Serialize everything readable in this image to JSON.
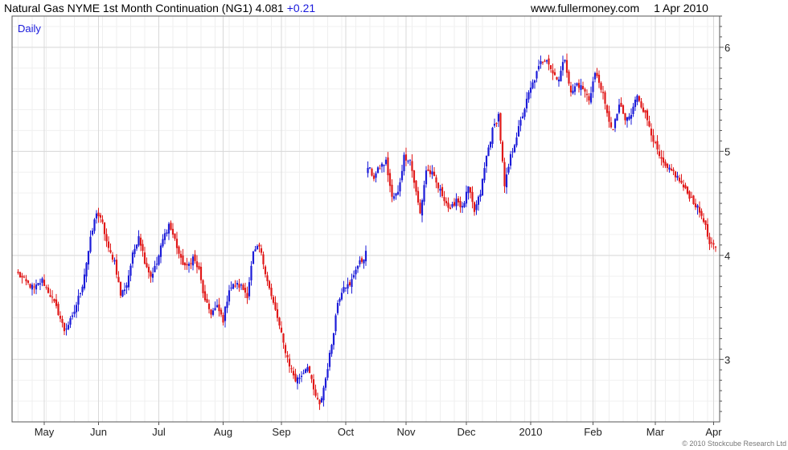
{
  "header": {
    "instrument": "Natural Gas NYME 1st Month Continuation (NG1)",
    "last": "4.081",
    "change": "+0.21",
    "site": "www.fullermoney.com",
    "date": "1 Apr 2010"
  },
  "copyright": "© 2010 Stockcube Research Ltd",
  "colors": {
    "up": "#1c1cd8",
    "down": "#e01818",
    "grid": "#d9d9d9",
    "axis": "#555555"
  },
  "chart_data": {
    "type": "candlestick",
    "period_label": "Daily",
    "y_ticks": [
      3,
      4,
      5,
      6
    ],
    "ylim": [
      2.4,
      6.3
    ],
    "x_tick_labels": [
      "May",
      "Jun",
      "Jul",
      "Aug",
      "Sep",
      "Oct",
      "Nov",
      "Dec",
      "2010",
      "Feb",
      "Mar",
      "Apr"
    ],
    "x_tick_days": [
      13,
      40,
      70,
      102,
      131,
      163,
      193,
      223,
      255,
      286,
      317,
      346
    ],
    "last_day": 347,
    "close_anchors": [
      [
        0,
        3.82
      ],
      [
        4,
        3.74
      ],
      [
        8,
        3.68
      ],
      [
        12,
        3.76
      ],
      [
        16,
        3.62
      ],
      [
        20,
        3.45
      ],
      [
        23,
        3.28
      ],
      [
        27,
        3.4
      ],
      [
        32,
        3.72
      ],
      [
        36,
        4.15
      ],
      [
        39,
        4.42
      ],
      [
        42,
        4.3
      ],
      [
        45,
        4.05
      ],
      [
        48,
        3.95
      ],
      [
        51,
        3.62
      ],
      [
        54,
        3.72
      ],
      [
        57,
        4.0
      ],
      [
        60,
        4.2
      ],
      [
        63,
        3.95
      ],
      [
        66,
        3.8
      ],
      [
        69,
        3.92
      ],
      [
        72,
        4.15
      ],
      [
        75,
        4.3
      ],
      [
        78,
        4.15
      ],
      [
        81,
        3.95
      ],
      [
        84,
        3.88
      ],
      [
        87,
        3.98
      ],
      [
        90,
        3.85
      ],
      [
        93,
        3.55
      ],
      [
        96,
        3.45
      ],
      [
        99,
        3.5
      ],
      [
        102,
        3.38
      ],
      [
        105,
        3.68
      ],
      [
        108,
        3.72
      ],
      [
        111,
        3.7
      ],
      [
        114,
        3.62
      ],
      [
        117,
        4.02
      ],
      [
        120,
        4.08
      ],
      [
        123,
        3.85
      ],
      [
        126,
        3.6
      ],
      [
        129,
        3.4
      ],
      [
        132,
        3.15
      ],
      [
        135,
        2.95
      ],
      [
        138,
        2.8
      ],
      [
        141,
        2.85
      ],
      [
        144,
        2.95
      ],
      [
        147,
        2.7
      ],
      [
        150,
        2.55
      ],
      [
        153,
        2.82
      ],
      [
        156,
        3.15
      ],
      [
        159,
        3.55
      ],
      [
        162,
        3.72
      ],
      [
        165,
        3.7
      ],
      [
        168,
        3.88
      ],
      [
        171,
        3.95
      ],
      [
        173,
        4.02
      ],
      [
        174,
        4.85
      ],
      [
        177,
        4.75
      ],
      [
        180,
        4.85
      ],
      [
        183,
        4.9
      ],
      [
        186,
        4.55
      ],
      [
        189,
        4.6
      ],
      [
        192,
        4.95
      ],
      [
        195,
        4.92
      ],
      [
        198,
        4.6
      ],
      [
        200,
        4.4
      ],
      [
        203,
        4.82
      ],
      [
        206,
        4.78
      ],
      [
        209,
        4.65
      ],
      [
        212,
        4.55
      ],
      [
        215,
        4.42
      ],
      [
        218,
        4.55
      ],
      [
        221,
        4.45
      ],
      [
        224,
        4.65
      ],
      [
        227,
        4.42
      ],
      [
        230,
        4.6
      ],
      [
        233,
        4.95
      ],
      [
        236,
        5.2
      ],
      [
        239,
        5.35
      ],
      [
        242,
        4.65
      ],
      [
        245,
        4.95
      ],
      [
        248,
        5.15
      ],
      [
        251,
        5.35
      ],
      [
        254,
        5.55
      ],
      [
        257,
        5.7
      ],
      [
        260,
        5.85
      ],
      [
        263,
        5.9
      ],
      [
        266,
        5.75
      ],
      [
        269,
        5.7
      ],
      [
        272,
        5.9
      ],
      [
        275,
        5.55
      ],
      [
        278,
        5.65
      ],
      [
        281,
        5.6
      ],
      [
        284,
        5.5
      ],
      [
        287,
        5.75
      ],
      [
        290,
        5.62
      ],
      [
        293,
        5.35
      ],
      [
        296,
        5.2
      ],
      [
        299,
        5.45
      ],
      [
        302,
        5.3
      ],
      [
        305,
        5.35
      ],
      [
        308,
        5.55
      ],
      [
        311,
        5.4
      ],
      [
        314,
        5.25
      ],
      [
        317,
        5.05
      ],
      [
        320,
        4.9
      ],
      [
        323,
        4.82
      ],
      [
        326,
        4.8
      ],
      [
        329,
        4.72
      ],
      [
        332,
        4.62
      ],
      [
        335,
        4.55
      ],
      [
        338,
        4.45
      ],
      [
        341,
        4.35
      ],
      [
        344,
        4.1
      ],
      [
        347,
        4.08
      ]
    ],
    "volatility": 0.028
  }
}
